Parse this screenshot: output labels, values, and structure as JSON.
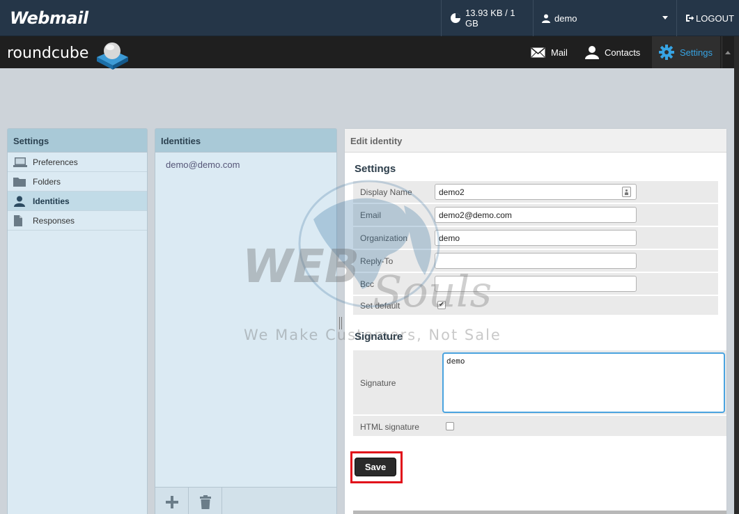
{
  "cpanel": {
    "brand": "Webmail",
    "quota": "13.93 KB / 1 GB",
    "user": "demo",
    "logout": "LOGOUT"
  },
  "roundcube": {
    "logo_text": "roundcube",
    "nav": {
      "mail": "Mail",
      "contacts": "Contacts",
      "settings": "Settings"
    }
  },
  "settings_panel": {
    "title": "Settings",
    "items": [
      {
        "label": "Preferences",
        "icon": "monitor-icon"
      },
      {
        "label": "Folders",
        "icon": "folder-icon"
      },
      {
        "label": "Identities",
        "icon": "person-icon",
        "active": true
      },
      {
        "label": "Responses",
        "icon": "document-icon"
      }
    ]
  },
  "identities_panel": {
    "title": "Identities",
    "items": [
      "demo@demo.com"
    ]
  },
  "edit_panel": {
    "title": "Edit identity",
    "settings_section": "Settings",
    "fields": {
      "display_name": {
        "label": "Display Name",
        "value": "demo2"
      },
      "email": {
        "label": "Email",
        "value": "demo2@demo.com"
      },
      "organization": {
        "label": "Organization",
        "value": "demo"
      },
      "reply_to": {
        "label": "Reply-To",
        "value": ""
      },
      "bcc": {
        "label": "Bcc",
        "value": ""
      },
      "set_default": {
        "label": "Set default",
        "checked": true
      }
    },
    "signature_section": "Signature",
    "signature": {
      "label": "Signature",
      "value": "demo"
    },
    "html_signature": {
      "label": "HTML signature",
      "checked": false
    },
    "save_label": "Save"
  },
  "watermark": {
    "word1": "WEB",
    "word2": "Souls",
    "tagline": "We Make Customers, Not Sale"
  },
  "colors": {
    "accent": "#37a4e4",
    "highlight": "#e1101a",
    "cpanel_bar": "#253648"
  }
}
